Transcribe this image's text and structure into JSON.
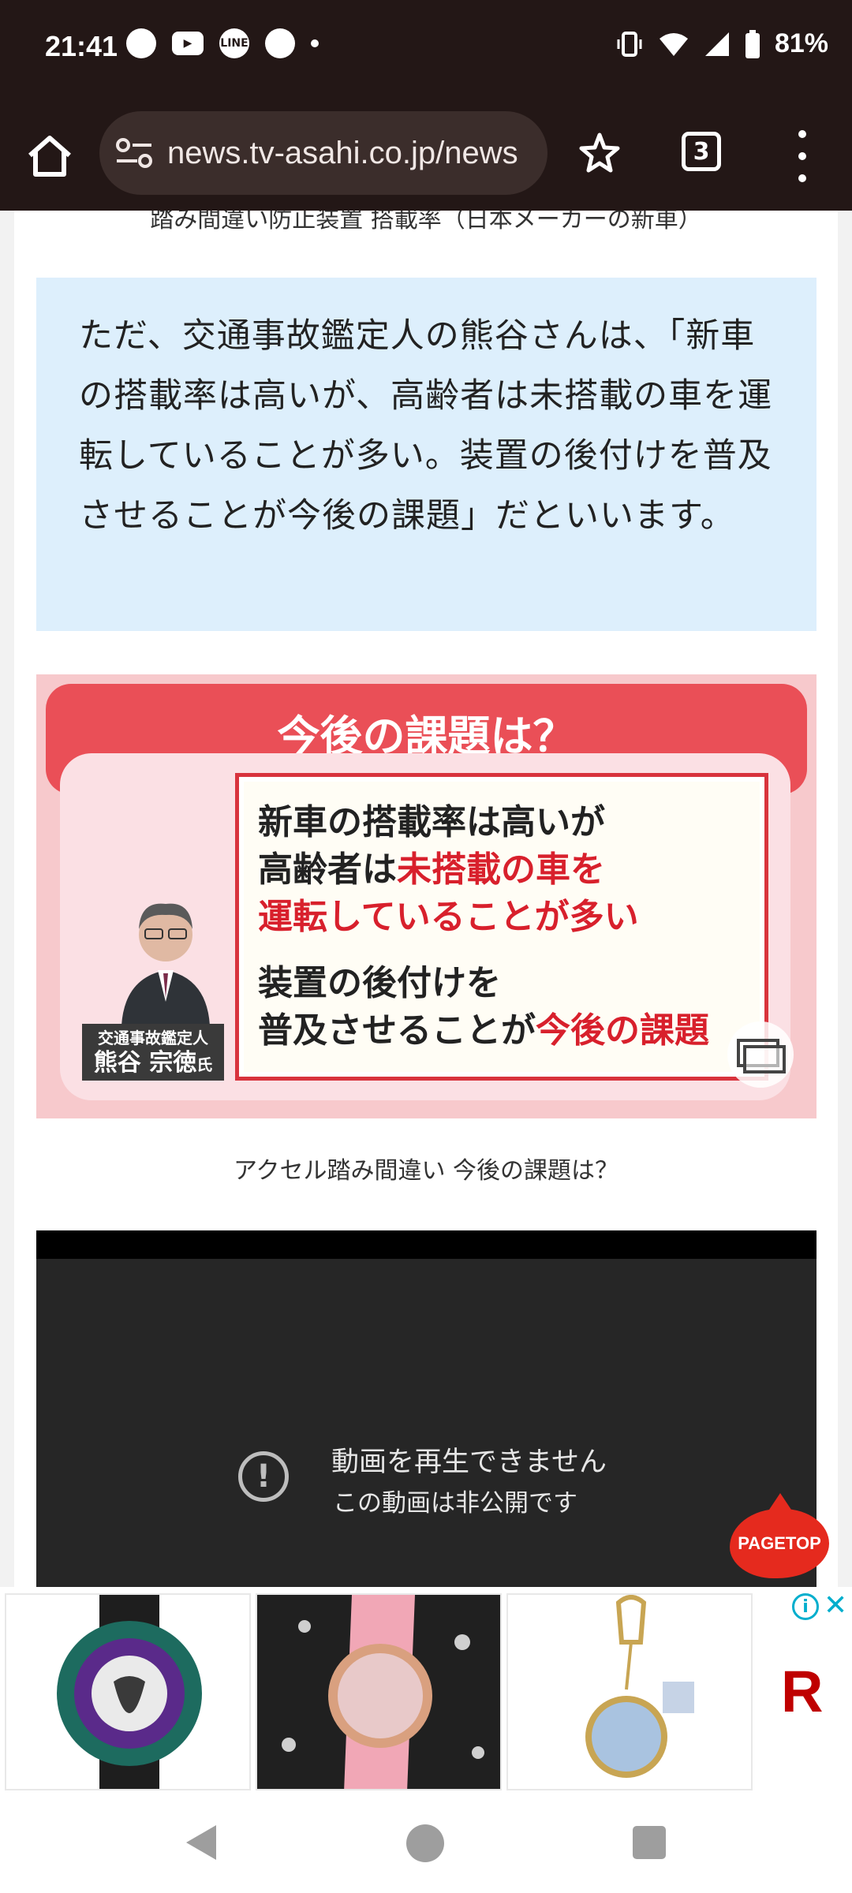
{
  "status_bar": {
    "time": "21:41",
    "battery": "81%",
    "notification_icons": [
      "chat-bubble-icon",
      "youtube-icon",
      "line-icon",
      "rabbit-icon",
      "dot-icon"
    ],
    "system_icons": [
      "vibrate-icon",
      "wifi-icon",
      "cell-signal-icon",
      "battery-icon"
    ]
  },
  "browser": {
    "url": "news.tv-asahi.co.jp/news",
    "tab_count": "3"
  },
  "article": {
    "cut_caption": "踏み間違い防止装置 搭載率（日本メーカーの新車）",
    "quote": "ただ、交通事故鑑定人の熊谷さんは、「新車の搭載率は高いが、高齢者は未搭載の車を運転していることが多い。装置の後付けを普及させることが今後の課題」だといいます。",
    "figure": {
      "title": "今後の課題は？",
      "line1": "新車の搭載率は高いが",
      "line2a": "高齢者は",
      "line2b": "未搭載の車を",
      "line3": "運転していることが多い",
      "line4": "装置の後付けを",
      "line5a": "普及させることが",
      "line5b": "今後の課題",
      "name_role": "交通事故鑑定人",
      "name": "熊谷 宗徳",
      "name_suffix": "氏"
    },
    "figure_caption": "アクセル踏み間違い 今後の課題は？"
  },
  "video": {
    "title": "動画を再生できません",
    "subtitle": "この動画は非公開です"
  },
  "pagetop_label": "PAGETOP",
  "ad": {
    "brand": "R",
    "info": "i",
    "close": "✕"
  },
  "colors": {
    "browser_bg": "#231716",
    "quote_bg": "#ddeffc",
    "banner_red": "#ea4f57",
    "accent_red": "#d8202c",
    "pagetop_red": "#e52a1e",
    "brand_red": "#bf0000",
    "ad_icon": "#00aecd"
  }
}
